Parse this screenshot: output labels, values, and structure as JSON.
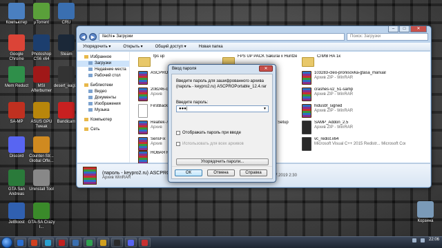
{
  "desktop_icons": [
    {
      "label": "Компьютер",
      "icon": "computer-icon",
      "color": "#4a7fc0"
    },
    {
      "label": "µTorrent",
      "icon": "utorrent-icon",
      "color": "#5aa03a"
    },
    {
      "label": "CRU",
      "icon": "cru-icon",
      "color": "#3a6fb0"
    },
    {
      "label": "Google Chrome",
      "icon": "chrome-icon",
      "color": "#db4437"
    },
    {
      "label": "Photoshop CS6 x64",
      "icon": "photoshop-icon",
      "color": "#1c3e6e"
    },
    {
      "label": "Steam",
      "icon": "steam-icon",
      "color": "#1b2838"
    },
    {
      "label": "Mem Reduct",
      "icon": "memreduct-icon",
      "color": "#2f8f4a"
    },
    {
      "label": "MSI Afterburner",
      "icon": "afterburner-icon",
      "color": "#a01818"
    },
    {
      "label": "desert_eagl...",
      "icon": "image-icon",
      "color": "#333333"
    },
    {
      "label": "SA-MP",
      "icon": "samp-icon",
      "color": "#c03020"
    },
    {
      "label": "ASUS GPU Tweak",
      "icon": "gputweak-icon",
      "color": "#b8860b"
    },
    {
      "label": "Bandicam",
      "icon": "bandicam-icon",
      "color": "#c82020"
    },
    {
      "label": "Discord",
      "icon": "discord-icon",
      "color": "#5865f2"
    },
    {
      "label": "Counter-Str... Global Offe...",
      "icon": "csgo-icon",
      "color": "#d08a20"
    },
    {
      "label": "GTA San Andreas",
      "icon": "gtasa-icon",
      "color": "#2a7a3a"
    },
    {
      "label": "Uninstall Tool",
      "icon": "uninstall-icon",
      "color": "#888888"
    },
    {
      "label": "JetBoost",
      "icon": "jetboost-icon",
      "color": "#3060b0"
    },
    {
      "label": "GTA-SA Crazy I...",
      "icon": "imged-icon",
      "color": "#3a8a2a"
    },
    {
      "label": "Корзина",
      "icon": "recycle-bin-icon",
      "color": "#7a9ab8"
    }
  ],
  "explorer": {
    "breadcrumb": "Ilachi ▸ Загрузки",
    "search_placeholder": "Поиск: Загрузки",
    "toolbar": [
      "Упорядочить ▾",
      "Открыть ▾",
      "Общий доступ ▾",
      "Новая папка"
    ],
    "nav": [
      {
        "label": "Избранное",
        "sub": false,
        "sel": false
      },
      {
        "label": "Загрузки",
        "sub": true,
        "sel": true
      },
      {
        "label": "Недавние места",
        "sub": true,
        "sel": false
      },
      {
        "label": "Рабочий стол",
        "sub": true,
        "sel": false
      },
      {
        "label": "",
        "gap": true
      },
      {
        "label": "Библиотеки",
        "sub": false,
        "sel": false
      },
      {
        "label": "Видео",
        "sub": true,
        "sel": false
      },
      {
        "label": "Документы",
        "sub": true,
        "sel": false
      },
      {
        "label": "Изображения",
        "sub": true,
        "sel": false
      },
      {
        "label": "Музыка",
        "sub": true,
        "sel": false
      },
      {
        "label": "",
        "gap": true
      },
      {
        "label": "Компьютер",
        "sub": false,
        "sel": false
      },
      {
        "label": "",
        "gap": true
      },
      {
        "label": "Сеть",
        "sub": false,
        "sel": false
      }
    ],
    "files": [
      {
        "name": "fps up",
        "type": "",
        "kind": "folder"
      },
      {
        "name": "ASCPRO",
        "type": "",
        "kind": "rar"
      },
      {
        "name": "208246-c",
        "type": "Архив",
        "kind": "rar"
      },
      {
        "name": "FirstBack",
        "type": "",
        "kind": "doc"
      },
      {
        "name": "Realtek-7",
        "type": "Архив",
        "kind": "rar"
      },
      {
        "name": "SensFix",
        "type": "Архив",
        "kind": "rar"
      },
      {
        "name": "НОВАЯ F",
        "type": "",
        "kind": "rar"
      },
      {
        "name": "FPS UP PACK Sakurai x Huntze",
        "type": "",
        "kind": "folder"
      },
      {
        "name": "Setup",
        "type": "",
        "kind": "none"
      },
      {
        "name": "СЛИВ НА 1к",
        "type": "",
        "kind": "folder"
      },
      {
        "name": "103283-cleo-pronisovka-gtasa_manual",
        "type": "Архив ZIP - WinRAR",
        "kind": "rar"
      },
      {
        "name": "crashes-v2_51-samp",
        "type": "Архив ZIP - WinRAR",
        "kind": "rar"
      },
      {
        "name": "hidusbf_signed",
        "type": "Архив ZIP - WinRAR",
        "kind": "rar"
      },
      {
        "name": "SAMP_Addon_2.5",
        "type": "Архив ZIP - WinRAR",
        "kind": "app"
      },
      {
        "name": "vc_redist.x64",
        "type": "Microsoft Visual C++ 2015 Redistr... Microsoft Corporation",
        "kind": "app"
      }
    ],
    "details": {
      "name": "(пароль - keypro2.ru) ASCPROPortable_12.4",
      "type": "Архив WinRAR",
      "modified": "Дата изменения: 03.07.2019 2:30"
    }
  },
  "dialog": {
    "title": "Ввод пароля",
    "close": "✕",
    "info": "Введите пароль для зашифрованного архива (пароль - keypro2.ru) ASCPROPortable_12.4.rar",
    "label": "Введите пароль:",
    "password": "●●●|",
    "show_password": "Отображать пароль при вводе",
    "use_all": "Использовать для всех архивов",
    "organize": "Упорядочить пароли...",
    "ok": "ОК",
    "cancel": "Отмена",
    "help": "Справка"
  },
  "taskbar": {
    "clock": "22:06",
    "apps": [
      "#2b6fd0",
      "#d04020",
      "#2aa0d0",
      "#c02020",
      "#3a6fb0",
      "#30a050",
      "#d0a020",
      "#2a2a2a",
      "#5865f2",
      "#c83030"
    ]
  }
}
